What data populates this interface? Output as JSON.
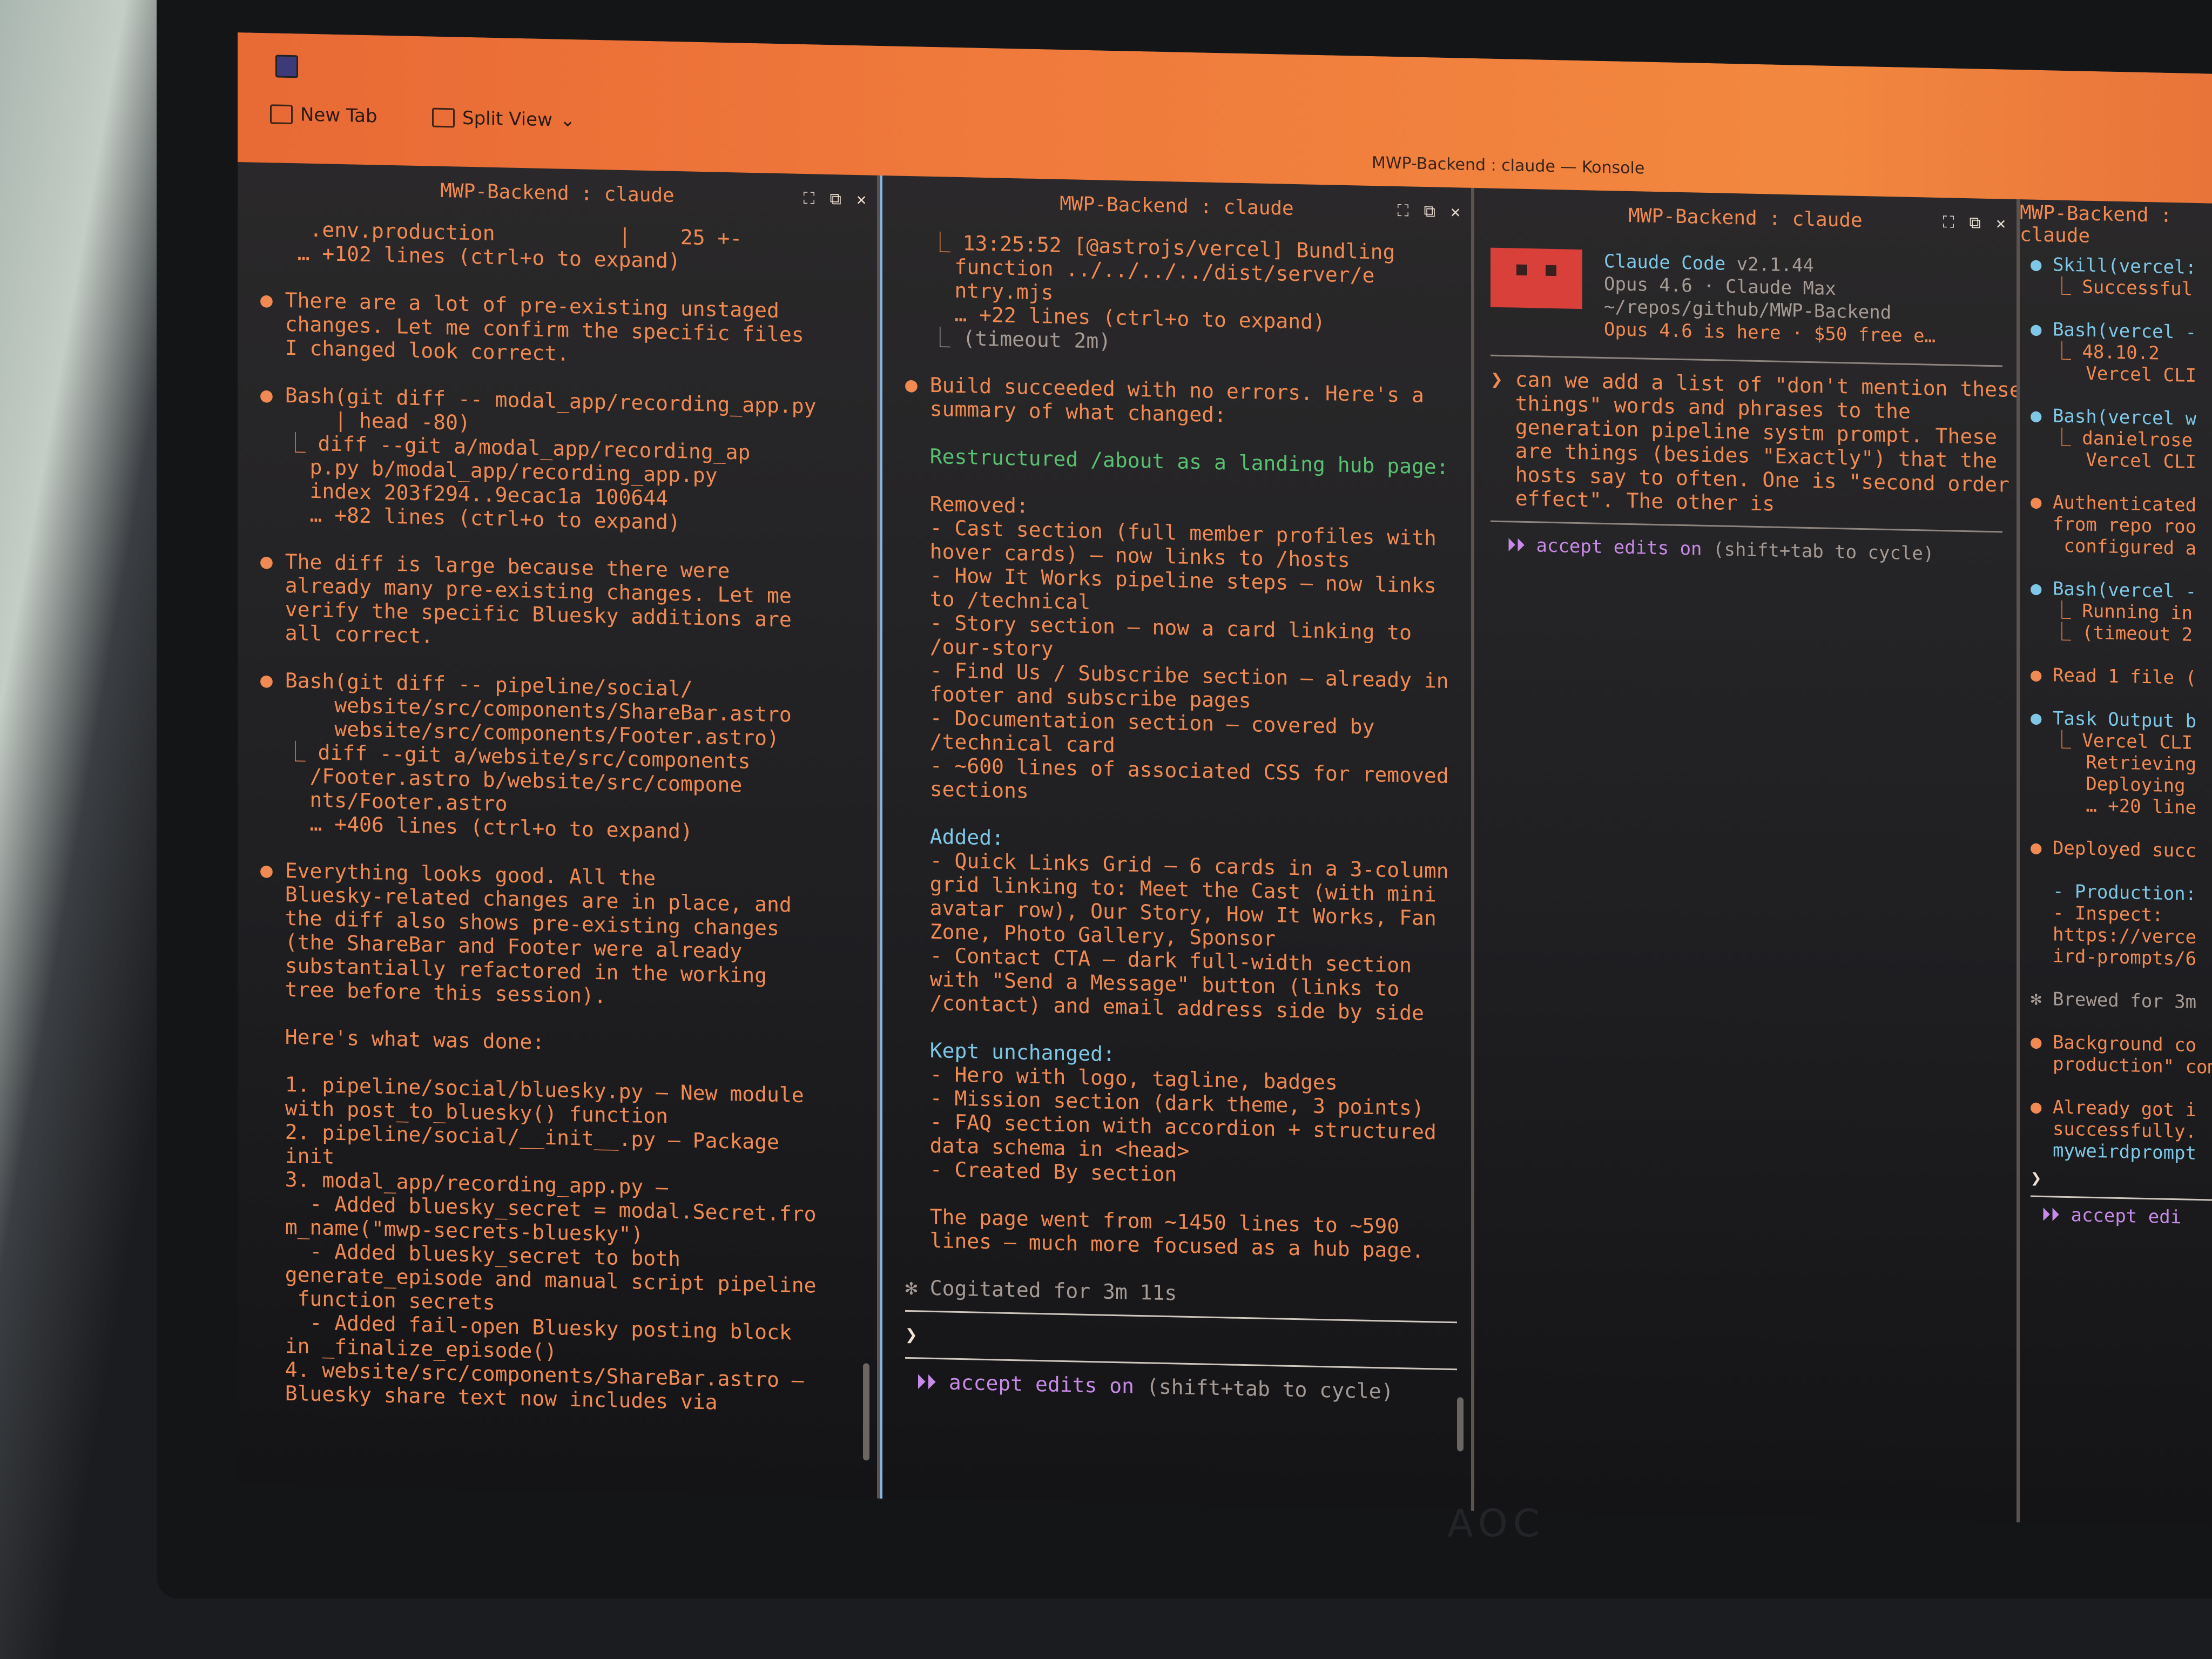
{
  "window": {
    "title": "MWP-Backend : claude — Konsole",
    "new_tab": "New Tab",
    "split_view": "Split View"
  },
  "pane_title": "MWP-Backend : claude",
  "pane1": {
    "lines": [
      {
        "t": "    .env.production          |    25 +-",
        "c": "orange"
      },
      {
        "t": "   … +102 lines (ctrl+o to expand)",
        "c": "orange"
      },
      {
        "t": "",
        "c": ""
      },
      {
        "t": "● There are a lot of pre-existing unstaged",
        "c": "orange"
      },
      {
        "t": "  changes. Let me confirm the specific files",
        "c": "orange"
      },
      {
        "t": "  I changed look correct.",
        "c": "orange"
      },
      {
        "t": "",
        "c": ""
      },
      {
        "t": "● Bash(git diff -- modal_app/recording_app.py",
        "c": "orange"
      },
      {
        "t": "      | head -80)",
        "c": "orange"
      },
      {
        "t": "  ⎿ diff --git a/modal_app/recording_ap",
        "c": "orange"
      },
      {
        "t": "    p.py b/modal_app/recording_app.py",
        "c": "orange"
      },
      {
        "t": "    index 203f294..9ecac1a 100644",
        "c": "orange"
      },
      {
        "t": "    … +82 lines (ctrl+o to expand)",
        "c": "orange"
      },
      {
        "t": "",
        "c": ""
      },
      {
        "t": "● The diff is large because there were",
        "c": "orange"
      },
      {
        "t": "  already many pre-existing changes. Let me",
        "c": "orange"
      },
      {
        "t": "  verify the specific Bluesky additions are",
        "c": "orange"
      },
      {
        "t": "  all correct.",
        "c": "orange"
      },
      {
        "t": "",
        "c": ""
      },
      {
        "t": "● Bash(git diff -- pipeline/social/",
        "c": "orange"
      },
      {
        "t": "      website/src/components/ShareBar.astro",
        "c": "orange"
      },
      {
        "t": "      website/src/components/Footer.astro)",
        "c": "orange"
      },
      {
        "t": "  ⎿ diff --git a/website/src/components",
        "c": "orange"
      },
      {
        "t": "    /Footer.astro b/website/src/compone",
        "c": "orange"
      },
      {
        "t": "    nts/Footer.astro",
        "c": "orange"
      },
      {
        "t": "    … +406 lines (ctrl+o to expand)",
        "c": "orange"
      },
      {
        "t": "",
        "c": ""
      },
      {
        "t": "● Everything looks good. All the",
        "c": "orange"
      },
      {
        "t": "  Bluesky-related changes are in place, and",
        "c": "orange"
      },
      {
        "t": "  the diff also shows pre-existing changes",
        "c": "orange"
      },
      {
        "t": "  (the ShareBar and Footer were already",
        "c": "orange"
      },
      {
        "t": "  substantially refactored in the working",
        "c": "orange"
      },
      {
        "t": "  tree before this session).",
        "c": "orange"
      },
      {
        "t": "",
        "c": ""
      },
      {
        "t": "  Here's what was done:",
        "c": "orange"
      },
      {
        "t": "",
        "c": ""
      },
      {
        "t": "  1. pipeline/social/bluesky.py — New module",
        "c": "orange"
      },
      {
        "t": "  with post_to_bluesky() function",
        "c": "orange"
      },
      {
        "t": "  2. pipeline/social/__init__.py — Package",
        "c": "orange"
      },
      {
        "t": "  init",
        "c": "orange"
      },
      {
        "t": "  3. modal_app/recording_app.py —",
        "c": "orange"
      },
      {
        "t": "    - Added bluesky_secret = modal.Secret.fro",
        "c": "orange"
      },
      {
        "t": "  m_name(\"mwp-secrets-bluesky\")",
        "c": "orange"
      },
      {
        "t": "    - Added bluesky_secret to both",
        "c": "orange"
      },
      {
        "t": "  generate_episode and manual script pipeline",
        "c": "orange"
      },
      {
        "t": "   function secrets",
        "c": "orange"
      },
      {
        "t": "    - Added fail-open Bluesky posting block",
        "c": "orange"
      },
      {
        "t": "  in _finalize_episode()",
        "c": "orange"
      },
      {
        "t": "  4. website/src/components/ShareBar.astro —",
        "c": "orange"
      },
      {
        "t": "  Bluesky share text now includes via",
        "c": "orange"
      }
    ]
  },
  "pane2": {
    "lines": [
      {
        "t": "  ⎿ 13:25:52 [@astrojs/vercel] Bundling",
        "c": "orange"
      },
      {
        "t": "    function ../../../../dist/server/e",
        "c": "orange"
      },
      {
        "t": "    ntry.mjs",
        "c": "orange"
      },
      {
        "t": "    … +22 lines (ctrl+o to expand)",
        "c": "orange"
      },
      {
        "t": "  ⎿ (timeout 2m)",
        "c": "dim"
      },
      {
        "t": "",
        "c": ""
      },
      {
        "t": "● Build succeeded with no errors. Here's a",
        "c": "orange"
      },
      {
        "t": "  summary of what changed:",
        "c": "orange"
      },
      {
        "t": "",
        "c": ""
      },
      {
        "t": "  Restructured /about as a landing hub page:",
        "c": "green"
      },
      {
        "t": "",
        "c": ""
      },
      {
        "t": "  Removed:",
        "c": "orange"
      },
      {
        "t": "  - Cast section (full member profiles with",
        "c": "orange"
      },
      {
        "t": "  hover cards) — now links to /hosts",
        "c": "orange"
      },
      {
        "t": "  - How It Works pipeline steps — now links",
        "c": "orange"
      },
      {
        "t": "  to /technical",
        "c": "orange"
      },
      {
        "t": "  - Story section — now a card linking to",
        "c": "orange"
      },
      {
        "t": "  /our-story",
        "c": "orange"
      },
      {
        "t": "  - Find Us / Subscribe section — already in",
        "c": "orange"
      },
      {
        "t": "  footer and subscribe pages",
        "c": "orange"
      },
      {
        "t": "  - Documentation section — covered by",
        "c": "orange"
      },
      {
        "t": "  /technical card",
        "c": "orange"
      },
      {
        "t": "  - ~600 lines of associated CSS for removed",
        "c": "orange"
      },
      {
        "t": "  sections",
        "c": "orange"
      },
      {
        "t": "",
        "c": ""
      },
      {
        "t": "  Added:",
        "c": "cyan"
      },
      {
        "t": "  - Quick Links Grid — 6 cards in a 3-column",
        "c": "orange"
      },
      {
        "t": "  grid linking to: Meet the Cast (with mini",
        "c": "orange"
      },
      {
        "t": "  avatar row), Our Story, How It Works, Fan",
        "c": "orange"
      },
      {
        "t": "  Zone, Photo Gallery, Sponsor",
        "c": "orange"
      },
      {
        "t": "  - Contact CTA — dark full-width section",
        "c": "orange"
      },
      {
        "t": "  with \"Send a Message\" button (links to",
        "c": "orange"
      },
      {
        "t": "  /contact) and email address side by side",
        "c": "orange"
      },
      {
        "t": "",
        "c": ""
      },
      {
        "t": "  Kept unchanged:",
        "c": "cyan"
      },
      {
        "t": "  - Hero with logo, tagline, badges",
        "c": "orange"
      },
      {
        "t": "  - Mission section (dark theme, 3 points)",
        "c": "orange"
      },
      {
        "t": "  - FAQ section with accordion + structured",
        "c": "orange"
      },
      {
        "t": "  data schema in <head>",
        "c": "orange"
      },
      {
        "t": "  - Created By section",
        "c": "orange"
      },
      {
        "t": "",
        "c": ""
      },
      {
        "t": "  The page went from ~1450 lines to ~590",
        "c": "orange"
      },
      {
        "t": "  lines — much more focused as a hub page.",
        "c": "orange"
      },
      {
        "t": "",
        "c": ""
      },
      {
        "t": "✻ Cogitated for 3m 11s",
        "c": "dim"
      }
    ],
    "prompt": "❯",
    "status": "⏵⏵ accept edits on",
    "status_hint": " (shift+tab to cycle)"
  },
  "pane3": {
    "app_name": "Claude Code",
    "version": " v2.1.44",
    "model_line": "Opus 4.6 · Claude Max",
    "path_line": "~/repos/github/MWP-Backend",
    "promo_line": "Opus 4.6 is here · $50 free e…",
    "message_lines": [
      "❯ can we add a list of \"don't mention these",
      "  things\" words and phrases to the",
      "  generation pipeline systm prompt. These",
      "  are things (besides \"Exactly\") that the",
      "  hosts say to often. One is \"second order",
      "  effect\". The other is"
    ],
    "status": "⏵⏵ accept edits on",
    "status_hint": " (shift+tab to cycle)"
  },
  "pane4": {
    "lines": [
      {
        "t": "● Skill(vercel:",
        "c": "cyan"
      },
      {
        "t": "  ⎿ Successful",
        "c": "orange"
      },
      {
        "t": "",
        "c": ""
      },
      {
        "t": "● Bash(vercel -",
        "c": "cyan"
      },
      {
        "t": "  ⎿ 48.10.2",
        "c": "orange"
      },
      {
        "t": "     Vercel CLI",
        "c": "orange"
      },
      {
        "t": "",
        "c": ""
      },
      {
        "t": "● Bash(vercel w",
        "c": "cyan"
      },
      {
        "t": "  ⎿ danielrose",
        "c": "orange"
      },
      {
        "t": "     Vercel CLI",
        "c": "orange"
      },
      {
        "t": "",
        "c": ""
      },
      {
        "t": "● Authenticated",
        "c": "orange"
      },
      {
        "t": "  from repo roo",
        "c": "orange"
      },
      {
        "t": "   configured a",
        "c": "orange"
      },
      {
        "t": "",
        "c": ""
      },
      {
        "t": "● Bash(vercel -",
        "c": "cyan"
      },
      {
        "t": "  ⎿ Running in",
        "c": "orange"
      },
      {
        "t": "  ⎿ (timeout 2",
        "c": "orange"
      },
      {
        "t": "",
        "c": ""
      },
      {
        "t": "● Read 1 file (",
        "c": "orange"
      },
      {
        "t": "",
        "c": ""
      },
      {
        "t": "● Task Output b",
        "c": "cyan"
      },
      {
        "t": "  ⎿ Vercel CLI",
        "c": "orange"
      },
      {
        "t": "     Retrieving",
        "c": "orange"
      },
      {
        "t": "     Deploying",
        "c": "orange"
      },
      {
        "t": "     … +20 line",
        "c": "orange"
      },
      {
        "t": "",
        "c": ""
      },
      {
        "t": "● Deployed succ",
        "c": "orange"
      },
      {
        "t": "",
        "c": ""
      },
      {
        "t": "  - Production:",
        "c": "cyan"
      },
      {
        "t": "  - Inspect:",
        "c": "orange"
      },
      {
        "t": "  https://verce",
        "c": "orange"
      },
      {
        "t": "  ird-prompts/6",
        "c": "orange"
      },
      {
        "t": "",
        "c": ""
      },
      {
        "t": "✻ Brewed for 3m",
        "c": "dim"
      },
      {
        "t": "",
        "c": ""
      },
      {
        "t": "● Background co",
        "c": "orange"
      },
      {
        "t": "  production\" com",
        "c": "orange"
      },
      {
        "t": "",
        "c": ""
      },
      {
        "t": "● Already got i",
        "c": "orange"
      },
      {
        "t": "  successfully.",
        "c": "orange"
      },
      {
        "t": "  myweirdprompt",
        "c": "cyan"
      }
    ],
    "prompt": "❯",
    "status": "⏵⏵ accept edi"
  },
  "colors": {
    "accent_orange": "#f08a52",
    "text_cream": "#f0e3d6",
    "bullet_green": "#4fbf52",
    "heading_cyan": "#7ec7e6",
    "claude_red": "#d9403a",
    "status_violet": "#c78ae6"
  },
  "icons": [
    "new-tab-icon",
    "split-view-icon",
    "chevron-down-icon",
    "maximize-pane-icon",
    "detach-pane-icon",
    "close-pane-icon",
    "claude-invader-icon"
  ]
}
